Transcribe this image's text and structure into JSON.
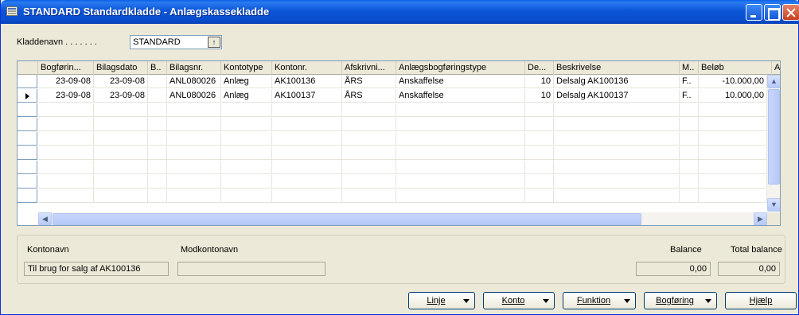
{
  "window": {
    "title": "STANDARD Standardkladde - Anlægskassekladde"
  },
  "journal": {
    "label": "Kladdenavn . . . . . . .",
    "value": "STANDARD",
    "lookup_glyph": "↑"
  },
  "grid": {
    "columns": [
      "Bogførin...",
      "Bilagsdato",
      "B..",
      "Bilagsnr.",
      "Kontotype",
      "Kontonr.",
      "Afskrivni...",
      "Anlægsbogføringstype",
      "De...",
      "Beskrivelse",
      "M..",
      "Beløb",
      "A"
    ],
    "rows": [
      {
        "bogforingsdato": "23-09-08",
        "bilagsdato": "23-09-08",
        "b": "",
        "bilagsnr": "ANL080026",
        "kontotype": "Anlæg",
        "kontonr": "AK100136",
        "afskrivning": "ÅRS",
        "anlaegstype": "Anskaffelse",
        "de": "10",
        "beskrivelse": "Delsalg AK100136",
        "m": "F..",
        "belob": "-10.000,00",
        "a": "",
        "selected": false
      },
      {
        "bogforingsdato": "23-09-08",
        "bilagsdato": "23-09-08",
        "b": "",
        "bilagsnr": "ANL080026",
        "kontotype": "Anlæg",
        "kontonr": "AK100137",
        "afskrivning": "ÅRS",
        "anlaegstype": "Anskaffelse",
        "de": "10",
        "beskrivelse": "Delsalg AK100137",
        "m": "F..",
        "belob": "10.000,00",
        "a": "",
        "selected": true
      }
    ],
    "empty_rows": 7
  },
  "info": {
    "kontonavn_label": "Kontonavn",
    "kontonavn_value": "Til brug for salg af AK100136",
    "modkontonavn_label": "Modkontonavn",
    "modkontonavn_value": "",
    "balance_label": "Balance",
    "balance_value": "0,00",
    "total_balance_label": "Total balance",
    "total_balance_value": "0,00"
  },
  "buttons": {
    "linje": "Linje",
    "konto": "Konto",
    "funktion": "Funktion",
    "bogforing": "Bogføring",
    "hjaelp": "Hjælp"
  }
}
